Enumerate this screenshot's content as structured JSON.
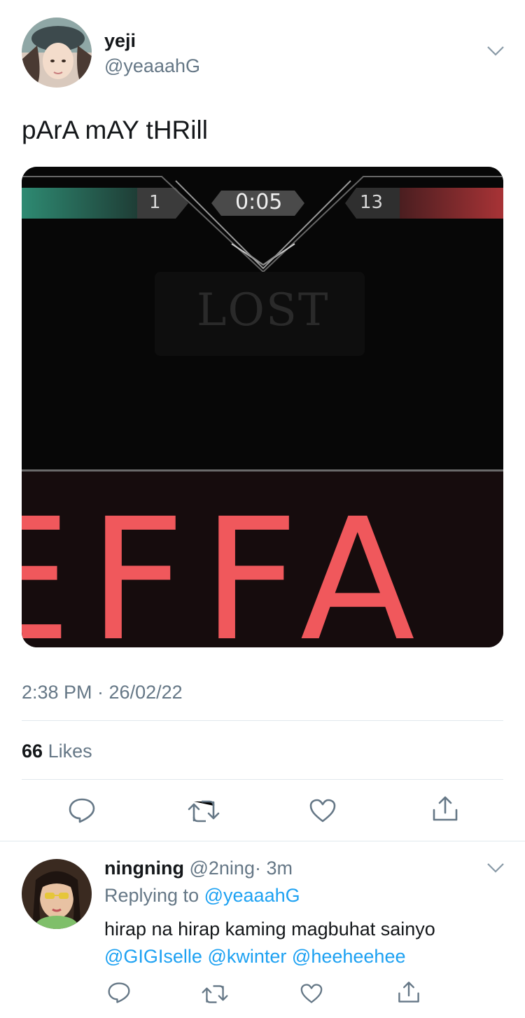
{
  "tweet": {
    "author": {
      "display_name": "yeji",
      "handle": "@yeaaahG"
    },
    "text": "pArA mAY tHRill",
    "media": {
      "game": {
        "left_score": "1",
        "timer": "0:05",
        "right_score": "13",
        "status": "LOST",
        "banner": "EFFA"
      },
      "colors": {
        "left_team": "#2e8a72",
        "right_team": "#a83336",
        "banner": "#f0585c"
      }
    },
    "timestamp": "2:38 PM · 26/02/22",
    "likes": {
      "count": "66",
      "label": "Likes"
    }
  },
  "reply": {
    "author": {
      "display_name": "ningning",
      "handle": "@2ning",
      "age": "· 3m"
    },
    "replying_to": {
      "prefix": "Replying to",
      "handle": "@yeaaahG"
    },
    "text": "hirap na hirap kaming magbuhat sainyo",
    "mentions": [
      "@GIGIselle",
      "@kwinter",
      "@heeheehee"
    ]
  },
  "icons": [
    "chevron-down-icon",
    "reply-icon",
    "retweet-icon",
    "like-icon",
    "share-icon"
  ],
  "colors": {
    "link": "#1da1f2",
    "muted": "#657786",
    "text": "#14171a"
  }
}
